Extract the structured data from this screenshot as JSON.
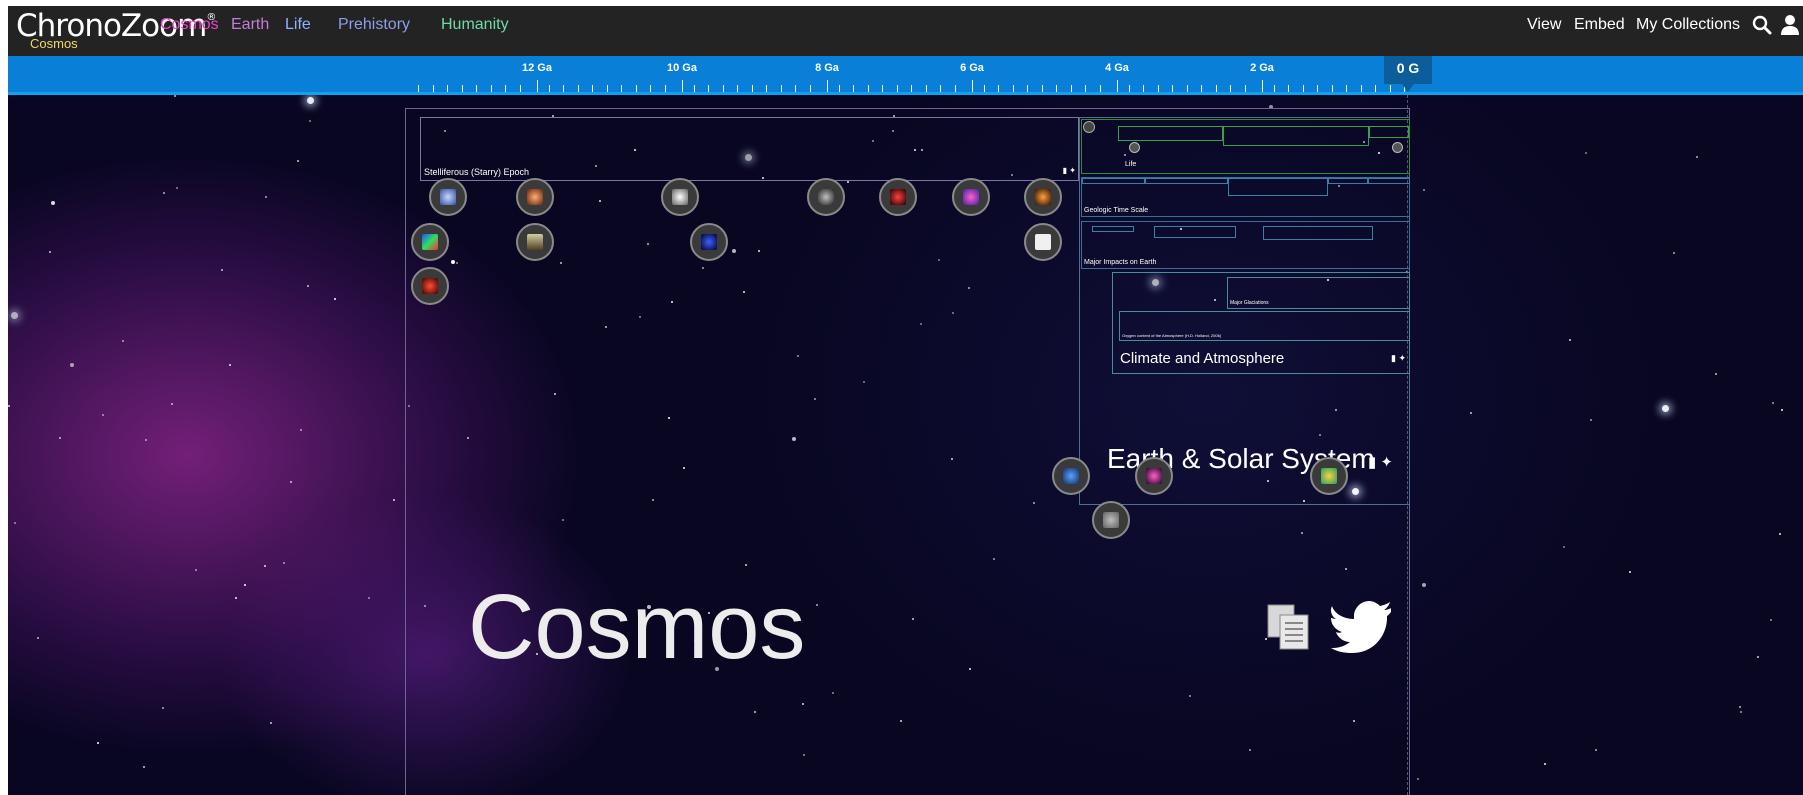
{
  "header": {
    "logo_text": "ChronoZoom",
    "logo_mark": "®",
    "breadcrumb": "Cosmos",
    "nav": [
      {
        "label": "Cosmos",
        "color": "#e846c9"
      },
      {
        "label": "Earth",
        "color": "#c67bd9"
      },
      {
        "label": "Life",
        "color": "#8fb1ff"
      },
      {
        "label": "Prehistory",
        "color": "#8b9fe8"
      },
      {
        "label": "Humanity",
        "color": "#6fd9a6"
      }
    ],
    "right": {
      "view": "View",
      "embed": "Embed",
      "collections": "My Collections"
    }
  },
  "ruler": {
    "labels": [
      "12 Ga",
      "10 Ga",
      "8 Ga",
      "6 Ga",
      "4 Ga",
      "2 Ga"
    ],
    "current": "0 G"
  },
  "timelines": {
    "stelliferous": "Stelliferous (Starry) Epoch",
    "life": "Life",
    "geologic": "Geologic Time Scale",
    "impacts": "Major Impacts on Earth",
    "glaciations": "Major Glaciations",
    "oxygen": "Oxygen content of the Atmosphere (H.D. Holland, 2006)",
    "climate": "Climate and Atmosphere",
    "earth_solar": "Earth & Solar System",
    "cosmos": "Cosmos"
  },
  "icons": {
    "search": "search-icon",
    "user": "user-icon",
    "copy": "copy-icon",
    "twitter": "twitter-icon"
  },
  "colors": {
    "topbar": "#232323",
    "ruler": "#0a7fd8",
    "breadcrumb": "#f2d76b"
  }
}
